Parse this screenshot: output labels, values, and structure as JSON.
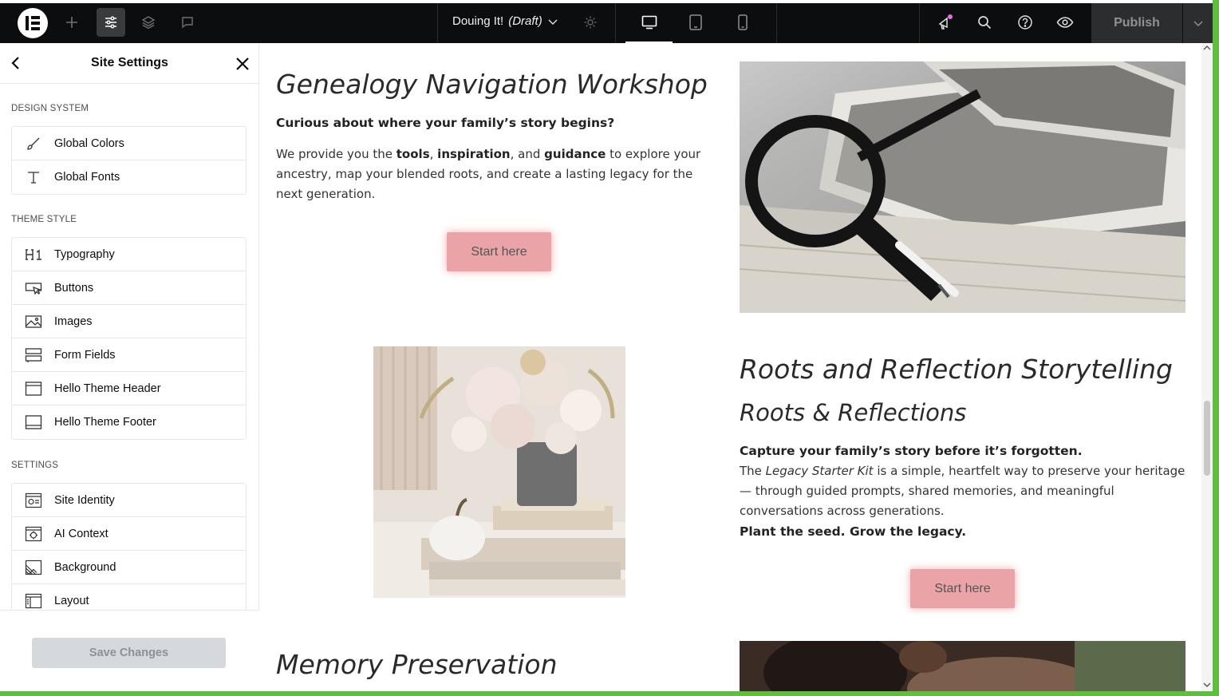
{
  "topbar": {
    "document_name": "Douing It!",
    "document_status": "(Draft)",
    "publish_label": "Publish",
    "logo_icon": "elementor-logo-icon"
  },
  "sidebar": {
    "title": "Site Settings",
    "sections": [
      {
        "title": "DESIGN SYSTEM",
        "items": [
          {
            "label": "Global Colors",
            "icon": "brush-icon"
          },
          {
            "label": "Global Fonts",
            "icon": "text-icon"
          }
        ]
      },
      {
        "title": "THEME STYLE",
        "items": [
          {
            "label": "Typography",
            "icon": "heading-icon"
          },
          {
            "label": "Buttons",
            "icon": "button-icon"
          },
          {
            "label": "Images",
            "icon": "image-icon"
          },
          {
            "label": "Form Fields",
            "icon": "form-icon"
          },
          {
            "label": "Hello Theme Header",
            "icon": "header-icon"
          },
          {
            "label": "Hello Theme Footer",
            "icon": "footer-icon"
          }
        ]
      },
      {
        "title": "SETTINGS",
        "items": [
          {
            "label": "Site Identity",
            "icon": "identity-icon"
          },
          {
            "label": "AI Context",
            "icon": "ai-icon"
          },
          {
            "label": "Background",
            "icon": "background-icon"
          },
          {
            "label": "Layout",
            "icon": "layout-icon"
          }
        ]
      }
    ],
    "save_label": "Save Changes"
  },
  "canvas": {
    "section1": {
      "heading": "Genealogy Navigation Workshop",
      "lead": "Curious about where your family’s story begins?",
      "p_we_provide": "We provide you the ",
      "p_tools": "tools",
      "p_comma1": ", ",
      "p_inspiration": "inspiration",
      "p_and": ", and ",
      "p_guidance": "guidance",
      "p_rest": " to explore your ancestry, map your blended roots, and create a lasting legacy for the next generation.",
      "button": "Start here"
    },
    "section2": {
      "heading": "Roots and Reflection Storytelling",
      "subheading": "Roots & Reflections",
      "lead": "Capture your family’s story before it’s forgotten.",
      "p_the": "The ",
      "p_kit": "Legacy Starter Kit",
      "p_rest": " is a simple, heartfelt way to preserve your heritage — through guided prompts, shared memories, and meaningful conversations across generations.",
      "tagline": "Plant the seed. Grow the legacy.",
      "button": "Start here"
    },
    "section3": {
      "heading": "Memory Preservation"
    }
  },
  "colors": {
    "topbar": "#0c0d0e",
    "button_pink": "#eaa4a8",
    "frame_green": "#5fbf3a",
    "notification_dot": "#e66ee6"
  }
}
